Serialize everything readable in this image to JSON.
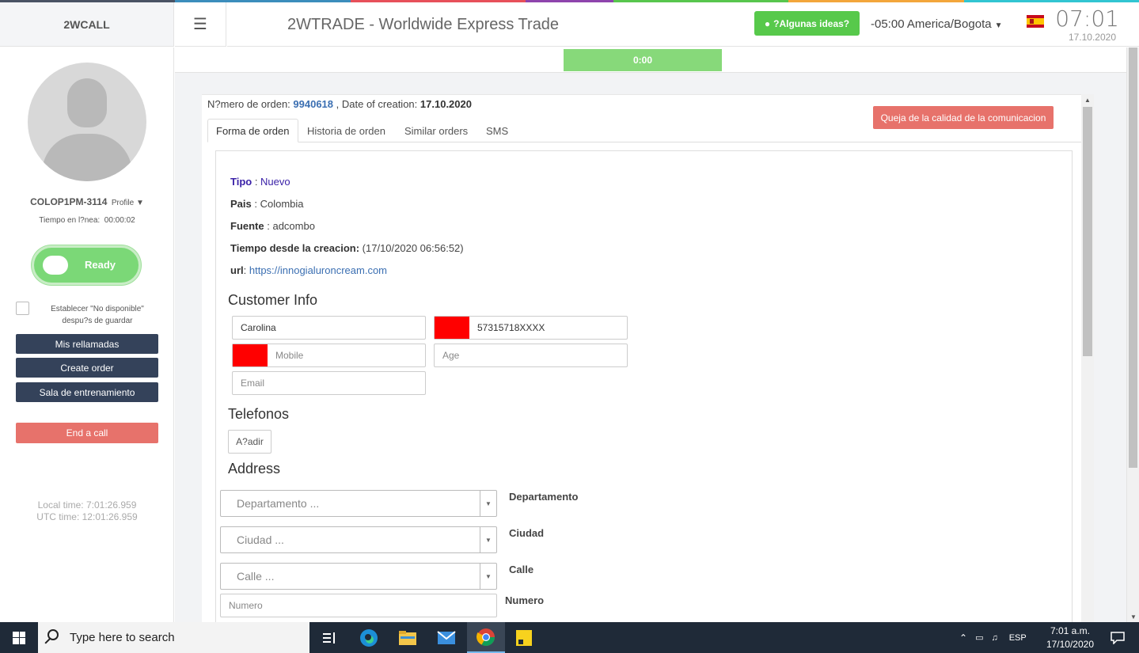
{
  "header": {
    "brand": "2WCALL",
    "menu_icon": "hamburger-icon",
    "app_title": "2WTRADE - Worldwide Express Trade",
    "ideas_button": "?Algunas ideas?",
    "timezone": "-05:00 America/Bogota",
    "time": "07:01",
    "date": "17.10.2020"
  },
  "sidebar": {
    "username": "COLOP1PM-3114",
    "profile_link": "Profile",
    "online_label": "Tiempo en l?nea:",
    "online_time": "00:00:02",
    "status": "Ready",
    "unavailable_line1": "Establecer \"No disponible\"",
    "unavailable_line2": "despu?s de guardar",
    "buttons": [
      "Mis rellamadas",
      "Create order",
      "Sala de entrenamiento"
    ],
    "end_call": "End a call",
    "local_time": "Local time: 7:01:26.959",
    "utc_time": "UTC time: 12:01:26.959"
  },
  "timer": "0:00",
  "order": {
    "number_label": "N?mero de orden:",
    "number": "9940618",
    "creation_label": ", Date of creation:",
    "creation_date": "17.10.2020",
    "quality_button": "Queja de la calidad de la comunicacion",
    "tabs": [
      "Forma de orden",
      "Historia de orden",
      "Similar orders",
      "SMS"
    ]
  },
  "form": {
    "tipo_label": "Tipo",
    "tipo_value": "Nuevo",
    "pais_label": "Pais",
    "pais_value": "Colombia",
    "fuente_label": "Fuente",
    "fuente_value": "adcombo",
    "tiempo_label": "Tiempo desde la creacion:",
    "tiempo_value": "(17/10/2020 06:56:52)",
    "url_label": "url",
    "url_value": "https://innogialuroncream.com",
    "customer_title": "Customer Info",
    "name_value": "Carolina",
    "phone_value": "57315718XXXX",
    "mobile_placeholder": "Mobile",
    "age_placeholder": "Age",
    "email_placeholder": "Email",
    "phones_title": "Telefonos",
    "add_button": "A?adir",
    "address_title": "Address",
    "departamento_placeholder": "Departamento ...",
    "departamento_label": "Departamento",
    "ciudad_placeholder": "Ciudad ...",
    "ciudad_label": "Ciudad",
    "calle_placeholder": "Calle ...",
    "calle_label": "Calle",
    "numero_placeholder": "Numero",
    "numero_label": "Numero"
  },
  "taskbar": {
    "search_placeholder": "Type here to search",
    "language": "ESP",
    "time": "7:01 a.m.",
    "date": "17/10/2020"
  },
  "colors": {
    "ready": "#7bd877",
    "end_call": "#e7726b",
    "sidebar_button": "#34425a",
    "ideas": "#57c94b",
    "link": "#3b6fb2",
    "flag_box": "#ff0000"
  }
}
